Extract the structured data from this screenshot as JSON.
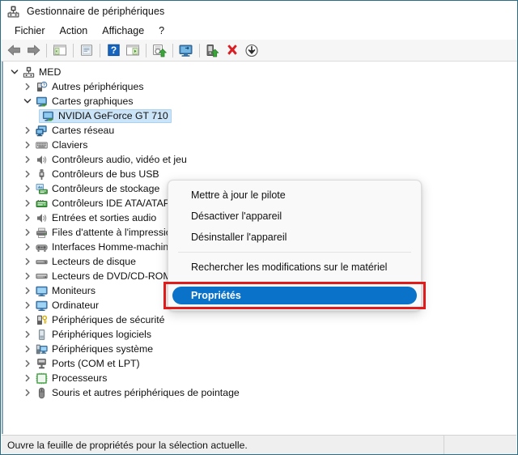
{
  "window": {
    "title": "Gestionnaire de périphériques",
    "icon": "device-manager-icon"
  },
  "menubar": {
    "items": [
      {
        "label": "Fichier"
      },
      {
        "label": "Action"
      },
      {
        "label": "Affichage"
      },
      {
        "label": "?"
      }
    ]
  },
  "toolbar": {
    "buttons": [
      {
        "name": "back-arrow-icon",
        "title": "Précédent"
      },
      {
        "name": "forward-arrow-icon",
        "title": "Suivant"
      },
      {
        "name": "show-hide-console-tree-icon",
        "title": "Afficher/Masquer l'arborescence de la console"
      },
      {
        "name": "properties-icon",
        "title": "Propriétés"
      },
      {
        "name": "help-icon",
        "title": "Aide"
      },
      {
        "name": "show-details-icon",
        "title": "Afficher le volet de détails"
      },
      {
        "name": "update-driver-icon",
        "title": "Mettre à jour le pilote"
      },
      {
        "name": "scan-hardware-changes-icon",
        "title": "Rechercher les modifications sur le matériel"
      },
      {
        "name": "enable-device-icon",
        "title": "Activer l'appareil"
      },
      {
        "name": "uninstall-device-icon",
        "title": "Désinstaller l'appareil"
      },
      {
        "name": "download-icon",
        "title": "Télécharger"
      }
    ]
  },
  "tree": {
    "root": {
      "label": "MED",
      "icon": "computer-icon",
      "expanded": true,
      "depth": 0
    },
    "items": [
      {
        "label": "Autres périphériques",
        "icon": "unknown-device-icon",
        "depth": 1,
        "expanded": false,
        "selected": false
      },
      {
        "label": "Cartes graphiques",
        "icon": "display-adapter-icon",
        "depth": 1,
        "expanded": true,
        "selected": false
      },
      {
        "label": "NVIDIA GeForce GT 710",
        "icon": "display-adapter-icon",
        "depth": 2,
        "expanded": null,
        "selected": true
      },
      {
        "label": "Cartes réseau",
        "icon": "network-adapter-icon",
        "depth": 1,
        "expanded": false,
        "selected": false
      },
      {
        "label": "Claviers",
        "icon": "keyboard-icon",
        "depth": 1,
        "expanded": false,
        "selected": false
      },
      {
        "label": "Contrôleurs audio, vidéo et jeu",
        "icon": "audio-icon",
        "depth": 1,
        "expanded": false,
        "selected": false
      },
      {
        "label": "Contrôleurs de bus USB",
        "icon": "usb-icon",
        "depth": 1,
        "expanded": false,
        "selected": false
      },
      {
        "label": "Contrôleurs de stockage",
        "icon": "storage-controller-icon",
        "depth": 1,
        "expanded": false,
        "selected": false
      },
      {
        "label": "Contrôleurs IDE ATA/ATAPI",
        "icon": "ide-controller-icon",
        "depth": 1,
        "expanded": false,
        "selected": false
      },
      {
        "label": "Entrées et sorties audio",
        "icon": "audio-icon",
        "depth": 1,
        "expanded": false,
        "selected": false
      },
      {
        "label": "Files d'attente à l'impression :",
        "icon": "printer-icon",
        "depth": 1,
        "expanded": false,
        "selected": false
      },
      {
        "label": "Interfaces Homme-machine",
        "icon": "hid-icon",
        "depth": 1,
        "expanded": false,
        "selected": false
      },
      {
        "label": "Lecteurs de disque",
        "icon": "disk-drive-icon",
        "depth": 1,
        "expanded": false,
        "selected": false
      },
      {
        "label": "Lecteurs de DVD/CD-ROM",
        "icon": "dvd-drive-icon",
        "depth": 1,
        "expanded": false,
        "selected": false
      },
      {
        "label": "Moniteurs",
        "icon": "monitor-icon",
        "depth": 1,
        "expanded": false,
        "selected": false
      },
      {
        "label": "Ordinateur",
        "icon": "computer-device-icon",
        "depth": 1,
        "expanded": false,
        "selected": false
      },
      {
        "label": "Périphériques de sécurité",
        "icon": "security-device-icon",
        "depth": 1,
        "expanded": false,
        "selected": false
      },
      {
        "label": "Périphériques logiciels",
        "icon": "software-device-icon",
        "depth": 1,
        "expanded": false,
        "selected": false
      },
      {
        "label": "Périphériques système",
        "icon": "system-device-icon",
        "depth": 1,
        "expanded": false,
        "selected": false
      },
      {
        "label": "Ports (COM et LPT)",
        "icon": "port-icon",
        "depth": 1,
        "expanded": false,
        "selected": false
      },
      {
        "label": "Processeurs",
        "icon": "processor-icon",
        "depth": 1,
        "expanded": false,
        "selected": false
      },
      {
        "label": "Souris et autres périphériques de pointage",
        "icon": "mouse-icon",
        "depth": 1,
        "expanded": false,
        "selected": false
      }
    ]
  },
  "context_menu": {
    "items": [
      {
        "label": "Mettre à jour le pilote",
        "highlighted": false
      },
      {
        "label": "Désactiver l'appareil",
        "highlighted": false
      },
      {
        "label": "Désinstaller l'appareil",
        "highlighted": false
      },
      {
        "separator": true
      },
      {
        "label": "Rechercher les modifications sur le matériel",
        "highlighted": false
      },
      {
        "separator": true
      },
      {
        "label": "Propriétés",
        "highlighted": true
      }
    ]
  },
  "statusbar": {
    "message": "Ouvre la feuille de propriétés pour la sélection actuelle.",
    "right": ""
  },
  "colors": {
    "selection_blue": "#0a72c8",
    "tree_selection": "#cce4f7",
    "annotation_red": "#e01b1b",
    "window_border": "#2a6d86"
  }
}
